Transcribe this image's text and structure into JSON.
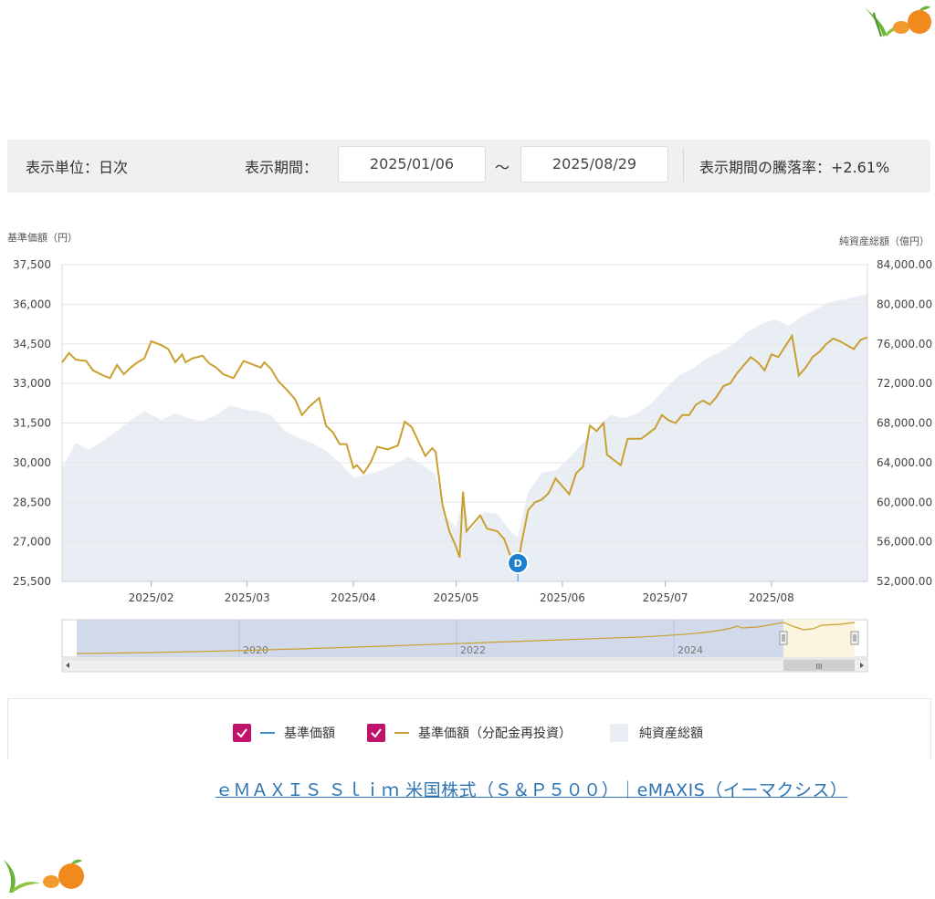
{
  "filter": {
    "unit_text": "表示単位：日次",
    "period_label": "表示期間：",
    "start_date": "2025/01/06",
    "tilde": "～",
    "end_date": "2025/08/29",
    "rate_text": "表示期間の騰落率：+2.61%"
  },
  "legend": {
    "items": [
      {
        "label": "基準価額",
        "checked": true,
        "color": "#3d8fd1"
      },
      {
        "label": "基準価額（分配金再投資）",
        "checked": true,
        "color": "#c9a030"
      },
      {
        "label": "純資産総額",
        "checked": false,
        "color": "#e9eef5"
      }
    ]
  },
  "link": {
    "text": "ｅＭＡＸＩＳ Ｓｌｉｍ 米国株式（Ｓ＆Ｐ５００）｜eMAXIS（イーマクシス）"
  },
  "chart_data": {
    "type": "line",
    "ylabel_left": "基準価額（円）",
    "ylabel_right": "純資産総額（億円）",
    "y_left_range": [
      25500,
      37500
    ],
    "y_left_ticks": [
      "37,500",
      "36,000",
      "34,500",
      "33,000",
      "31,500",
      "30,000",
      "28,500",
      "27,000",
      "25,500"
    ],
    "y_right_range": [
      52000,
      84000
    ],
    "y_right_ticks": [
      "84,000.00",
      "80,000.00",
      "76,000.00",
      "72,000.00",
      "68,000.00",
      "64,000.00",
      "60,000.00",
      "56,000.00",
      "52,000.00"
    ],
    "x_range": [
      "2025-01-06",
      "2025-08-29"
    ],
    "x_ticks": [
      {
        "label": "2025/02",
        "date": "2025-02-01"
      },
      {
        "label": "2025/03",
        "date": "2025-03-01"
      },
      {
        "label": "2025/04",
        "date": "2025-04-01"
      },
      {
        "label": "2025/05",
        "date": "2025-05-01"
      },
      {
        "label": "2025/06",
        "date": "2025-06-01"
      },
      {
        "label": "2025/07",
        "date": "2025-07-01"
      },
      {
        "label": "2025/08",
        "date": "2025-08-01"
      }
    ],
    "grid": true,
    "series": [
      {
        "name": "基準価額（分配金再投資）",
        "color": "#c9a030",
        "axis": "left",
        "points": [
          [
            "2025-01-06",
            33800
          ],
          [
            "2025-01-08",
            34150
          ],
          [
            "2025-01-10",
            33900
          ],
          [
            "2025-01-13",
            33850
          ],
          [
            "2025-01-15",
            33500
          ],
          [
            "2025-01-18",
            33300
          ],
          [
            "2025-01-20",
            33200
          ],
          [
            "2025-01-22",
            33700
          ],
          [
            "2025-01-24",
            33350
          ],
          [
            "2025-01-26",
            33600
          ],
          [
            "2025-01-28",
            33800
          ],
          [
            "2025-01-30",
            33950
          ],
          [
            "2025-02-01",
            34600
          ],
          [
            "2025-02-04",
            34450
          ],
          [
            "2025-02-06",
            34300
          ],
          [
            "2025-02-08",
            33800
          ],
          [
            "2025-02-10",
            34100
          ],
          [
            "2025-02-11",
            33800
          ],
          [
            "2025-02-13",
            33950
          ],
          [
            "2025-02-16",
            34050
          ],
          [
            "2025-02-18",
            33750
          ],
          [
            "2025-02-20",
            33600
          ],
          [
            "2025-02-22",
            33350
          ],
          [
            "2025-02-25",
            33200
          ],
          [
            "2025-02-28",
            33850
          ],
          [
            "2025-03-02",
            33750
          ],
          [
            "2025-03-05",
            33600
          ],
          [
            "2025-03-06",
            33800
          ],
          [
            "2025-03-08",
            33550
          ],
          [
            "2025-03-10",
            33100
          ],
          [
            "2025-03-13",
            32700
          ],
          [
            "2025-03-15",
            32400
          ],
          [
            "2025-03-17",
            31800
          ],
          [
            "2025-03-19",
            32100
          ],
          [
            "2025-03-22",
            32450
          ],
          [
            "2025-03-24",
            31400
          ],
          [
            "2025-03-26",
            31150
          ],
          [
            "2025-03-28",
            30700
          ],
          [
            "2025-03-30",
            30700
          ],
          [
            "2025-04-01",
            29800
          ],
          [
            "2025-04-02",
            29900
          ],
          [
            "2025-04-04",
            29600
          ],
          [
            "2025-04-06",
            30000
          ],
          [
            "2025-04-08",
            30600
          ],
          [
            "2025-04-11",
            30500
          ],
          [
            "2025-04-14",
            30650
          ],
          [
            "2025-04-16",
            31550
          ],
          [
            "2025-04-18",
            31350
          ],
          [
            "2025-04-20",
            30800
          ],
          [
            "2025-04-22",
            30250
          ],
          [
            "2025-04-24",
            30550
          ],
          [
            "2025-04-25",
            30400
          ],
          [
            "2025-04-27",
            28400
          ],
          [
            "2025-04-29",
            27400
          ],
          [
            "2025-05-01",
            26800
          ],
          [
            "2025-05-02",
            26400
          ],
          [
            "2025-05-03",
            28900
          ],
          [
            "2025-05-04",
            27400
          ],
          [
            "2025-05-06",
            27700
          ],
          [
            "2025-05-08",
            28000
          ],
          [
            "2025-05-10",
            27500
          ],
          [
            "2025-05-13",
            27400
          ],
          [
            "2025-05-15",
            27100
          ],
          [
            "2025-05-17",
            26400
          ],
          [
            "2025-05-18",
            26100
          ],
          [
            "2025-05-19",
            26100
          ],
          [
            "2025-05-20",
            26900
          ],
          [
            "2025-05-22",
            28200
          ],
          [
            "2025-05-24",
            28500
          ],
          [
            "2025-05-26",
            28600
          ],
          [
            "2025-05-28",
            28850
          ],
          [
            "2025-05-30",
            29400
          ],
          [
            "2025-06-01",
            29100
          ],
          [
            "2025-06-03",
            28800
          ],
          [
            "2025-06-05",
            29600
          ],
          [
            "2025-06-07",
            29850
          ],
          [
            "2025-06-09",
            31400
          ],
          [
            "2025-06-11",
            31200
          ],
          [
            "2025-06-13",
            31500
          ],
          [
            "2025-06-14",
            30300
          ],
          [
            "2025-06-16",
            30100
          ],
          [
            "2025-06-18",
            29900
          ],
          [
            "2025-06-20",
            30900
          ],
          [
            "2025-06-22",
            30900
          ],
          [
            "2025-06-24",
            30900
          ],
          [
            "2025-06-26",
            31100
          ],
          [
            "2025-06-28",
            31300
          ],
          [
            "2025-06-30",
            31800
          ],
          [
            "2025-07-02",
            31600
          ],
          [
            "2025-07-04",
            31500
          ],
          [
            "2025-07-06",
            31800
          ],
          [
            "2025-07-08",
            31800
          ],
          [
            "2025-07-10",
            32200
          ],
          [
            "2025-07-12",
            32350
          ],
          [
            "2025-07-14",
            32200
          ],
          [
            "2025-07-16",
            32500
          ],
          [
            "2025-07-18",
            32900
          ],
          [
            "2025-07-20",
            33000
          ],
          [
            "2025-07-22",
            33400
          ],
          [
            "2025-07-24",
            33700
          ],
          [
            "2025-07-26",
            34000
          ],
          [
            "2025-07-28",
            33800
          ],
          [
            "2025-07-30",
            33500
          ],
          [
            "2025-08-01",
            34100
          ],
          [
            "2025-08-03",
            34000
          ],
          [
            "2025-08-05",
            34400
          ],
          [
            "2025-08-07",
            34800
          ],
          [
            "2025-08-09",
            33300
          ],
          [
            "2025-08-11",
            33600
          ],
          [
            "2025-08-13",
            34000
          ],
          [
            "2025-08-15",
            34200
          ],
          [
            "2025-08-17",
            34500
          ],
          [
            "2025-08-19",
            34700
          ],
          [
            "2025-08-21",
            34600
          ],
          [
            "2025-08-23",
            34450
          ],
          [
            "2025-08-25",
            34300
          ],
          [
            "2025-08-27",
            34650
          ],
          [
            "2025-08-29",
            34750
          ]
        ]
      },
      {
        "name": "純資産総額",
        "color": "#e9eef5",
        "axis": "right",
        "type": "area",
        "points": [
          [
            "2025-01-06",
            63500
          ],
          [
            "2025-01-10",
            66000
          ],
          [
            "2025-01-14",
            65300
          ],
          [
            "2025-01-18",
            66200
          ],
          [
            "2025-01-22",
            67200
          ],
          [
            "2025-01-26",
            68300
          ],
          [
            "2025-01-30",
            69200
          ],
          [
            "2025-02-04",
            68300
          ],
          [
            "2025-02-08",
            69000
          ],
          [
            "2025-02-12",
            68500
          ],
          [
            "2025-02-16",
            68200
          ],
          [
            "2025-02-20",
            68800
          ],
          [
            "2025-02-24",
            69800
          ],
          [
            "2025-02-28",
            69400
          ],
          [
            "2025-03-04",
            69200
          ],
          [
            "2025-03-08",
            68800
          ],
          [
            "2025-03-12",
            67200
          ],
          [
            "2025-03-16",
            66500
          ],
          [
            "2025-03-20",
            66000
          ],
          [
            "2025-03-24",
            65200
          ],
          [
            "2025-03-28",
            64000
          ],
          [
            "2025-04-01",
            62500
          ],
          [
            "2025-04-05",
            62800
          ],
          [
            "2025-04-09",
            63200
          ],
          [
            "2025-04-13",
            63800
          ],
          [
            "2025-04-17",
            64600
          ],
          [
            "2025-04-21",
            63800
          ],
          [
            "2025-04-25",
            62800
          ],
          [
            "2025-04-28",
            58500
          ],
          [
            "2025-05-01",
            57500
          ],
          [
            "2025-05-03",
            60800
          ],
          [
            "2025-05-05",
            57000
          ],
          [
            "2025-05-09",
            59000
          ],
          [
            "2025-05-13",
            58800
          ],
          [
            "2025-05-17",
            57000
          ],
          [
            "2025-05-19",
            56500
          ],
          [
            "2025-05-22",
            61000
          ],
          [
            "2025-05-26",
            63000
          ],
          [
            "2025-05-30",
            63200
          ],
          [
            "2025-06-03",
            64500
          ],
          [
            "2025-06-07",
            66000
          ],
          [
            "2025-06-11",
            67500
          ],
          [
            "2025-06-15",
            68800
          ],
          [
            "2025-06-19",
            68500
          ],
          [
            "2025-06-23",
            69000
          ],
          [
            "2025-06-27",
            70000
          ],
          [
            "2025-07-01",
            71500
          ],
          [
            "2025-07-05",
            72800
          ],
          [
            "2025-07-09",
            73500
          ],
          [
            "2025-07-13",
            74500
          ],
          [
            "2025-07-17",
            75200
          ],
          [
            "2025-07-21",
            76000
          ],
          [
            "2025-07-25",
            77200
          ],
          [
            "2025-07-29",
            78000
          ],
          [
            "2025-08-02",
            78500
          ],
          [
            "2025-08-06",
            77800
          ],
          [
            "2025-08-10",
            78800
          ],
          [
            "2025-08-14",
            79500
          ],
          [
            "2025-08-18",
            80200
          ],
          [
            "2025-08-22",
            80500
          ],
          [
            "2025-08-26",
            80800
          ],
          [
            "2025-08-29",
            81000
          ]
        ]
      }
    ],
    "annotations": [
      {
        "label": "D",
        "date": "2025-05-19",
        "value": 25500
      }
    ],
    "navigator": {
      "x_labels": [
        "2020",
        "2022",
        "2024"
      ]
    }
  }
}
